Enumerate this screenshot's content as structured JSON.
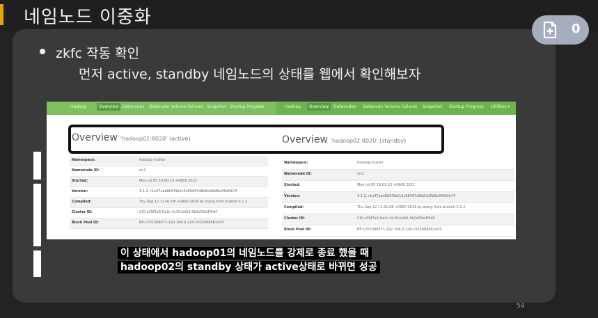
{
  "slide": {
    "title": "네임노드 이중화",
    "bullet": "zkfc 작동 확인",
    "subline": "먼저 active, standby 네임노드의 상태를 웹에서 확인해보자",
    "caption_line1": "이 상태에서 hadoop01의 네임노드를 강제로 종료 했을 때",
    "caption_line2": "hadoop02의 standby 상태가 active상태로 바뀌면 성공",
    "page_number": "54"
  },
  "badge": {
    "icon": "add-document-icon",
    "count": "0"
  },
  "screenshot": {
    "left": {
      "nav": [
        "Hadoop",
        "Overview",
        "Datanodes",
        "Datanode Volume Failures",
        "Snapshot",
        "Startup Progress"
      ],
      "overview_title": "Overview",
      "overview_host": "'hadoop01:8020' (active)",
      "rows": [
        {
          "key": "Namespace:",
          "value": "hadoop-cluster"
        },
        {
          "key": "Namenode ID:",
          "value": "nn1"
        },
        {
          "key": "Started:",
          "value": "Mon Jul 05 14:00:19 +0900 2021"
        },
        {
          "key": "Version:",
          "value": "3.1.2, r1e47aee8b5f3b0c3c88497d8d2dd5b8a3f6d0b74"
        },
        {
          "key": "Compiled:",
          "value": "Thu Sep 12 11:41:08 +0900 2019 by ztang from branch-3.1.2"
        },
        {
          "key": "Cluster ID:",
          "value": "CID-c09f7a9-0a2c-4c10-b2b5-0b2e55e3f9d4"
        },
        {
          "key": "Block Pool ID:",
          "value": "BP-1701098071-192.168.0.128-1625468461443"
        }
      ]
    },
    "right": {
      "nav": [
        "Hadoop",
        "Overview",
        "Datanodes",
        "Datanode Volume Failures",
        "Snapshot",
        "Startup Progress",
        "Utilities ▾"
      ],
      "overview_title": "Overview",
      "overview_host": "'hadoop02:8020' (standby)",
      "rows": [
        {
          "key": "Namespace:",
          "value": "hadoop-cluster"
        },
        {
          "key": "Namenode ID:",
          "value": "nn2"
        },
        {
          "key": "Started:",
          "value": "Mon Jul 05 19:01:23 +0900 2021"
        },
        {
          "key": "Version:",
          "value": "3.1.2, r1e47aee8b5f3b0c3c88497d8d2dd5b8a3f6d0b74"
        },
        {
          "key": "Compiled:",
          "value": "Thu Sep 12 11:41:08 +0900 2019 by ztang from branch-3.1.2"
        },
        {
          "key": "Cluster ID:",
          "value": "CID-c09f7a9-0a2c-4c10-b2b5-0b2e55e3f9d4"
        },
        {
          "key": "Block Pool ID:",
          "value": "BP-1701098071-192.168.0.128-1625468461443"
        }
      ]
    }
  }
}
